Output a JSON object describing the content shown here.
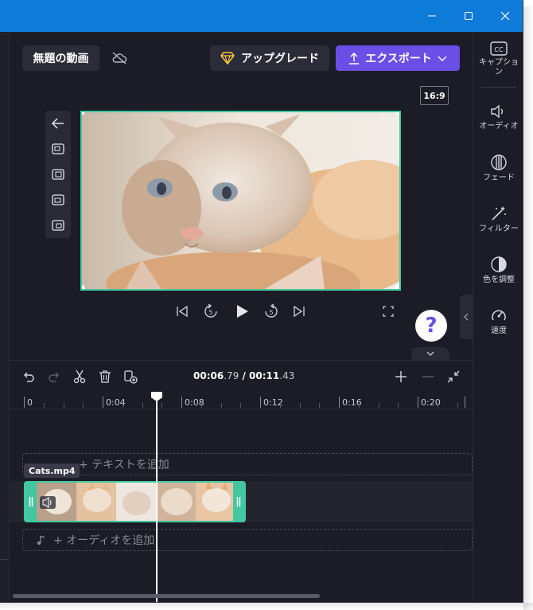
{
  "window": {
    "controls": {
      "minimize": "minimize-icon",
      "maximize": "maximize-icon",
      "close": "close-icon"
    }
  },
  "header": {
    "project_title": "無題の動画",
    "cloud_status_icon": "cloud-off-icon",
    "upgrade_label": "アップグレード",
    "export_label": "エクスポート",
    "aspect_ratio": "16:9"
  },
  "colors": {
    "accent": "#6b4ee6",
    "selection": "#42c7a0",
    "titlebar": "#0f7bd8",
    "background": "#1c1c26",
    "upgrade_icon": "#f5c542"
  },
  "right_panel": {
    "items": [
      {
        "label": "キャプション",
        "icon": "captions-icon"
      },
      {
        "label": "オーディオ",
        "icon": "speaker-icon"
      },
      {
        "label": "フェード",
        "icon": "fade-icon"
      },
      {
        "label": "フィルター",
        "icon": "magic-wand-icon"
      },
      {
        "label": "色を調整",
        "icon": "contrast-icon"
      },
      {
        "label": "速度",
        "icon": "speedometer-icon"
      }
    ]
  },
  "timeline": {
    "current_time_main": "00:06",
    "current_time_frac": ".79",
    "separator": " / ",
    "total_time_main": "00:11",
    "total_time_frac": ".43",
    "ruler_labels": [
      "0",
      "0:04",
      "0:08",
      "0:12",
      "0:16",
      "0:20"
    ],
    "text_lane_placeholder": "+ テキストを追加",
    "audio_lane_placeholder": "+ オーディオを追加",
    "clip_name": "Cats.mp4"
  }
}
